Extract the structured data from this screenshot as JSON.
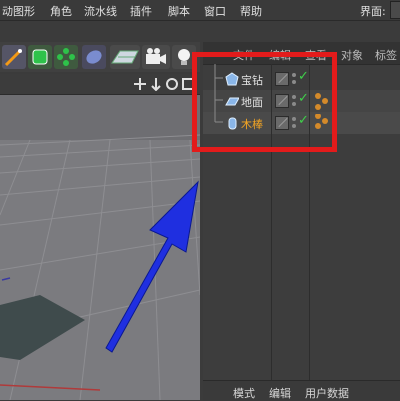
{
  "menubar": {
    "items": [
      "动图形",
      "角色",
      "流水线",
      "插件",
      "脚本",
      "窗口",
      "帮助"
    ],
    "layout_label": "界面:"
  },
  "right_panel": {
    "tabs": [
      "文件",
      "编辑",
      "查看",
      "对象",
      "标签"
    ],
    "objects": [
      {
        "name": "宝钻",
        "icon": "gem-object-icon",
        "selected": false
      },
      {
        "name": "地面",
        "icon": "floor-object-icon",
        "selected": false
      },
      {
        "name": "木棒",
        "icon": "cylinder-object-icon",
        "selected": true
      }
    ]
  },
  "bottombar": {
    "items": [
      "模式",
      "编辑",
      "用户数据"
    ]
  },
  "colors": {
    "highlight": "#e31b1b",
    "arrow": "#1f2fe0",
    "check": "#3fd04a",
    "selected_text": "#f5a623"
  }
}
